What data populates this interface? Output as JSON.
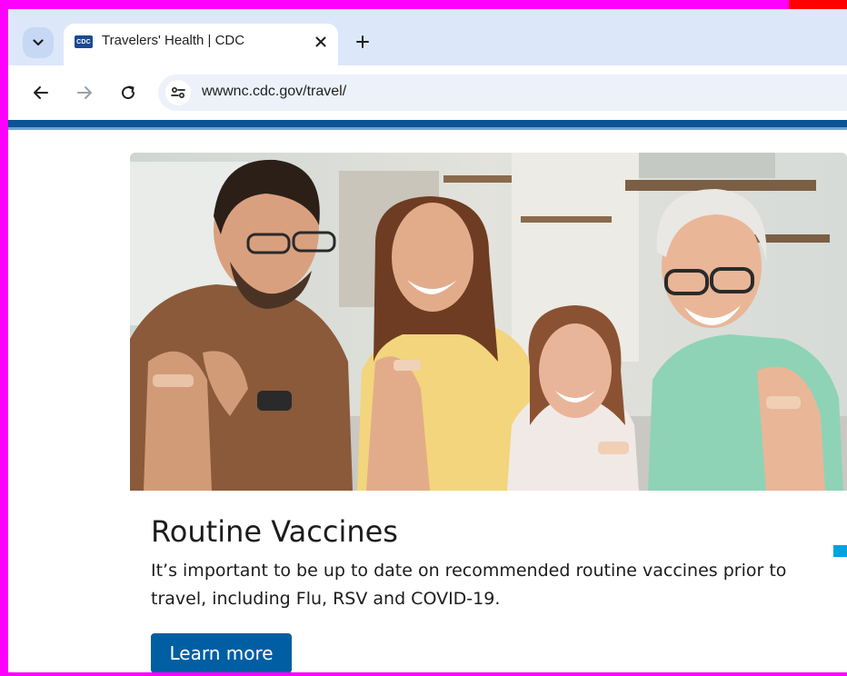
{
  "browser": {
    "tab": {
      "title": "Travelers' Health | CDC",
      "favicon_text": "CDC",
      "close_glyph": "✕"
    },
    "new_tab_glyph": "+",
    "url": "wwwnc.cdc.gov/travel/",
    "icons": [
      "chevron-down-icon",
      "back-arrow-icon",
      "forward-arrow-icon",
      "reload-icon",
      "site-info-icon",
      "close-icon",
      "plus-icon"
    ]
  },
  "card": {
    "title": "Routine Vaccines",
    "description": "It’s important to be up to date on recommended routine vaccines prior to travel, including Flu, RSV and COVID-19.",
    "button_label": "Learn more"
  },
  "colors": {
    "cdc_blue": "#0b5394",
    "button_blue": "#005ea2",
    "carousel_accent": "#00a3e0",
    "frame_magenta": "#ff00ff"
  }
}
